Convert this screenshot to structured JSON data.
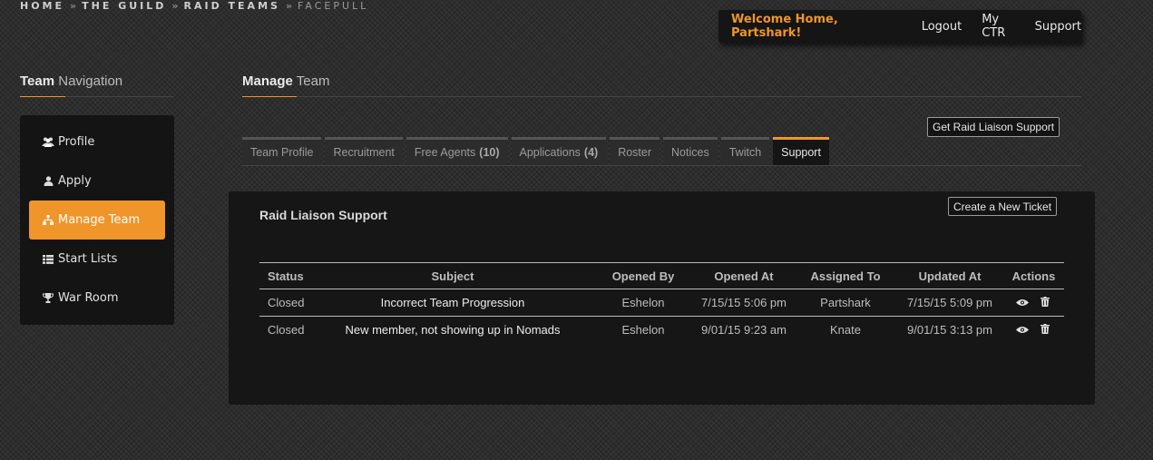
{
  "breadcrumb": [
    "HOME",
    "THE GUILD",
    "RAID TEAMS",
    "FACEPULL"
  ],
  "breadcrumb_separator": "»",
  "userbar": {
    "welcome": "Welcome Home, Partshark!",
    "logout": "Logout",
    "my_ctr": "My CTR",
    "support": "Support"
  },
  "sidebar": {
    "title_bold": "Team",
    "title_rest": "Navigation",
    "items": [
      {
        "label": "Profile",
        "icon": "users-icon"
      },
      {
        "label": "Apply",
        "icon": "user-icon"
      },
      {
        "label": "Manage Team",
        "icon": "sitemap-icon",
        "active": true
      },
      {
        "label": "Start Lists",
        "icon": "list-icon"
      },
      {
        "label": "War Room",
        "icon": "trophy-icon"
      }
    ]
  },
  "main": {
    "title_bold": "Manage",
    "title_rest": "Team",
    "raid_liaison_button": "Get Raid Liaison Support",
    "tabs": [
      {
        "label": "Team Profile"
      },
      {
        "label": "Recruitment"
      },
      {
        "label": "Free Agents",
        "count": "(10)"
      },
      {
        "label": "Applications",
        "count": "(4)"
      },
      {
        "label": "Roster"
      },
      {
        "label": "Notices"
      },
      {
        "label": "Twitch"
      },
      {
        "label": "Support",
        "active": true
      }
    ]
  },
  "panel": {
    "title": "Raid Liaison Support",
    "new_ticket_button": "Create a New Ticket",
    "columns": [
      "Status",
      "Subject",
      "Opened By",
      "Opened At",
      "Assigned To",
      "Updated At",
      "Actions"
    ],
    "rows": [
      {
        "status": "Closed",
        "subject": "Incorrect Team Progression",
        "opened_by": "Eshelon",
        "opened_at": "7/15/15 5:06 pm",
        "assigned_to": "Partshark",
        "updated_at": "7/15/15 5:09 pm"
      },
      {
        "status": "Closed",
        "subject": "New member, not showing up in Nomads",
        "opened_by": "Eshelon",
        "opened_at": "9/01/15 9:23 am",
        "assigned_to": "Knate",
        "updated_at": "9/01/15 3:13 pm"
      }
    ]
  },
  "colors": {
    "accent": "#f0952a",
    "panel": "#161616",
    "background": "#2b2b2b"
  }
}
